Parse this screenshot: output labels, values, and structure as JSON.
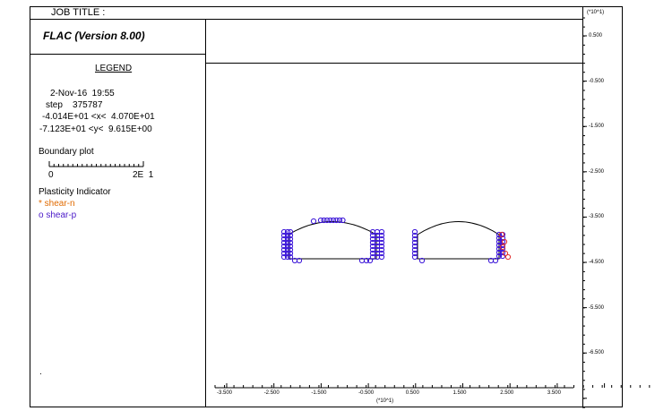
{
  "header": {
    "job_title": "JOB TITLE :",
    "scale_top_right": "(*10^1)"
  },
  "app": {
    "name": "FLAC (Version 8.00)"
  },
  "legend": {
    "heading": "LEGEND",
    "date_time": "2-Nov-16  19:55",
    "step": "step    375787",
    "x_range": "-4.014E+01 <x<  4.070E+01",
    "y_range": "-7.123E+01 <y<  9.615E+00",
    "boundary_title": "Boundary plot",
    "boundary_min": "0",
    "boundary_max": "2E  1",
    "plasticity_title": "Plasticity Indicator",
    "shear_n": "* shear-n",
    "shear_p": "o shear-p",
    "dot": "."
  },
  "axes": {
    "x_ticks": [
      "-3.500",
      "-2.500",
      "-1.500",
      "-0.500",
      "0.500",
      "1.500",
      "2.500",
      "3.500"
    ],
    "x_scale": "(*10^1)",
    "y_ticks": [
      "0.500",
      "-0.500",
      "-1.500",
      "-2.500",
      "-3.500",
      "-4.500",
      "-5.500",
      "-6.500"
    ]
  },
  "colors": {
    "shear_n": "#e03030",
    "shear_p": "#3a14d8"
  }
}
